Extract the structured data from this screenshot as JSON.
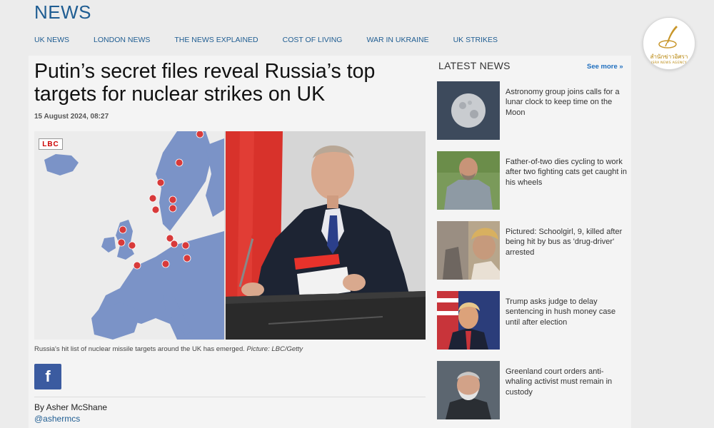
{
  "header": {
    "brand": "NEWS",
    "nav": [
      "UK NEWS",
      "LONDON NEWS",
      "THE NEWS EXPLAINED",
      "COST OF LIVING",
      "WAR IN UKRAINE",
      "UK STRIKES"
    ]
  },
  "logo": {
    "thai": "สำนักข่าวอิศรา",
    "english": "ISRA NEWS AGENCY"
  },
  "article": {
    "title": "Putin’s secret files reveal Russia’s top targets for nuclear strikes on UK",
    "date": "15 August 2024, 08:27",
    "image_badge": "LBC",
    "caption": "Russia's hit list of nuclear missile targets around the UK has emerged.",
    "caption_credit": "Picture: LBC/Getty",
    "share_icon": "f",
    "byline": "By Asher McShane",
    "handle": "@ashermcs"
  },
  "sidebar": {
    "title": "LATEST NEWS",
    "see_more": "See more »",
    "items": [
      {
        "text": "Astronomy group joins calls for a lunar clock to keep time on the Moon"
      },
      {
        "text": "Father-of-two dies cycling to work after two fighting cats get caught in his wheels"
      },
      {
        "text": "Pictured: Schoolgirl, 9, killed after being hit by bus as 'drug-driver' arrested"
      },
      {
        "text": "Trump asks judge to delay sentencing in hush money case until after election"
      },
      {
        "text": "Greenland court orders anti-whaling activist must remain in custody"
      }
    ]
  },
  "colors": {
    "brand_blue": "#1f5d92",
    "link_blue": "#1f6fbf",
    "facebook": "#3b5ba0",
    "map_land": "#7b93c7",
    "target_red": "#d83a3a"
  }
}
